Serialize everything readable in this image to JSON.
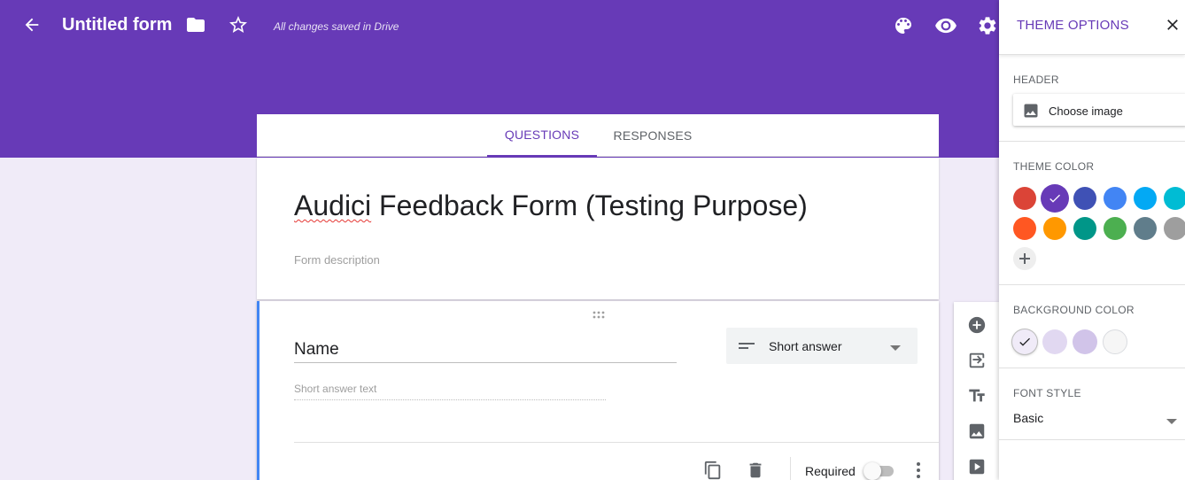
{
  "colors": {
    "brand": "#673ab7",
    "page_bg": "#f0ebf8",
    "active_border": "#4285f4"
  },
  "top_bar": {
    "form_title": "Untitled form",
    "save_status": "All changes saved in Drive",
    "icons": [
      "back-arrow-icon",
      "folder-icon",
      "star-icon",
      "palette-icon",
      "eye-icon",
      "gear-icon"
    ]
  },
  "tabs": [
    {
      "label": "QUESTIONS",
      "active": true
    },
    {
      "label": "RESPONSES",
      "active": false
    }
  ],
  "form": {
    "title": "Audici Feedback Form (Testing Purpose)",
    "description_placeholder": "Form description"
  },
  "question": {
    "title": "Name",
    "type_label": "Short answer",
    "answer_hint": "Short answer text",
    "required_label": "Required",
    "required": false
  },
  "side_toolbar": {
    "icons": [
      "add-circle-icon",
      "import-questions-icon",
      "title-text-icon",
      "image-icon",
      "video-icon"
    ]
  },
  "theme_panel": {
    "title": "THEME OPTIONS",
    "header_label": "HEADER",
    "choose_image_label": "Choose image",
    "theme_color_label": "THEME COLOR",
    "theme_colors": [
      "#db4437",
      "#673ab7",
      "#3f51b5",
      "#4285f4",
      "#03a9f4",
      "#00bcd4",
      "#ff5722",
      "#ff9800",
      "#009688",
      "#4caf50",
      "#607d8b",
      "#9e9e9e"
    ],
    "selected_theme_color": "#673ab7",
    "background_color_label": "BACKGROUND COLOR",
    "background_colors": [
      "#f0ebf8",
      "#e1d8f1",
      "#d1c4e9",
      "#f6f6f6"
    ],
    "selected_background_color": "#f0ebf8",
    "font_style_label": "FONT STYLE",
    "font_style_value": "Basic"
  }
}
